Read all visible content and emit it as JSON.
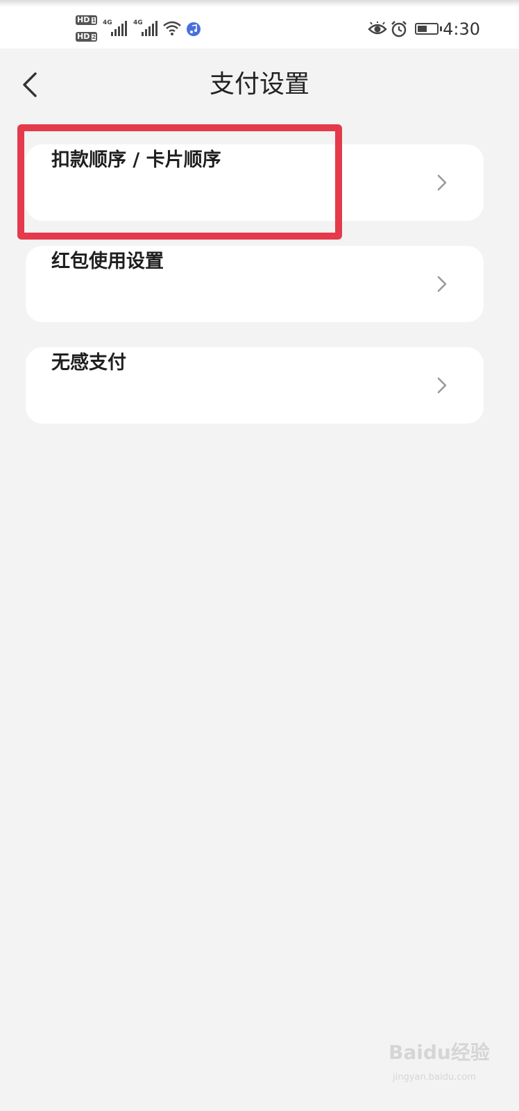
{
  "status_bar": {
    "hd1": "HD",
    "hd1_sim": "1",
    "hd2": "HD",
    "hd2_sim": "2",
    "net1": "4G",
    "net2": "4G",
    "time": "4:30",
    "icons": [
      "hd-icon",
      "signal-icon",
      "wifi-icon",
      "music-icon",
      "eye-icon",
      "alarm-icon",
      "battery-icon"
    ]
  },
  "header": {
    "title": "支付设置",
    "back_icon": "chevron-left-icon"
  },
  "menu": {
    "items": [
      {
        "label": "扣款顺序 / 卡片顺序",
        "icon": "chevron-right-icon"
      },
      {
        "label": "红包使用设置",
        "icon": "chevron-right-icon"
      },
      {
        "label": "无感支付",
        "icon": "chevron-right-icon"
      }
    ]
  },
  "highlight": {
    "color": "#e43a4b"
  },
  "watermark": {
    "text_main": "Bai",
    "text_du": "du",
    "text_cn": "经验",
    "text_sub": "jingyan.baidu.com"
  },
  "colors": {
    "background": "#f3f3f3",
    "card": "#ffffff",
    "accent": "#e43a4b"
  }
}
